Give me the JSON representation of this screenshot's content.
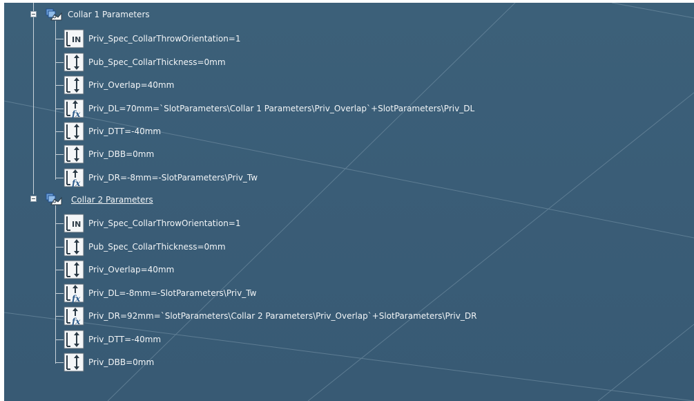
{
  "tree": {
    "sets": [
      {
        "name": "Collar 1 Parameters",
        "selected": false,
        "parameters": [
          {
            "icon": "integer-parameter-icon",
            "label": "Priv_Spec_CollarThrowOrientation=1"
          },
          {
            "icon": "length-parameter-icon",
            "label": "Pub_Spec_CollarThickness=0mm"
          },
          {
            "icon": "length-parameter-icon",
            "label": "Priv_Overlap=40mm"
          },
          {
            "icon": "formula-parameter-icon",
            "label": "Priv_DL=70mm=`SlotParameters\\Collar 1 Parameters\\Priv_Overlap`+SlotParameters\\Priv_DL"
          },
          {
            "icon": "length-parameter-icon",
            "label": "Priv_DTT=-40mm"
          },
          {
            "icon": "length-parameter-icon",
            "label": "Priv_DBB=0mm"
          },
          {
            "icon": "formula-parameter-icon",
            "label": "Priv_DR=-8mm=-SlotParameters\\Priv_Tw"
          }
        ]
      },
      {
        "name": "Collar 2 Parameters",
        "selected": true,
        "parameters": [
          {
            "icon": "integer-parameter-icon",
            "label": "Priv_Spec_CollarThrowOrientation=1"
          },
          {
            "icon": "length-parameter-icon",
            "label": "Pub_Spec_CollarThickness=0mm"
          },
          {
            "icon": "length-parameter-icon",
            "label": "Priv_Overlap=40mm"
          },
          {
            "icon": "formula-parameter-icon",
            "label": "Priv_DL=-8mm=-SlotParameters\\Priv_Tw"
          },
          {
            "icon": "formula-parameter-icon",
            "label": "Priv_DR=92mm=`SlotParameters\\Collar 2 Parameters\\Priv_Overlap`+SlotParameters\\Priv_DR"
          },
          {
            "icon": "length-parameter-icon",
            "label": "Priv_DTT=-40mm"
          },
          {
            "icon": "length-parameter-icon",
            "label": "Priv_DBB=0mm"
          }
        ]
      }
    ]
  },
  "colors": {
    "background": "#3a5d77",
    "text": "#f2f5f7",
    "tree_line": "#c9d3da"
  }
}
